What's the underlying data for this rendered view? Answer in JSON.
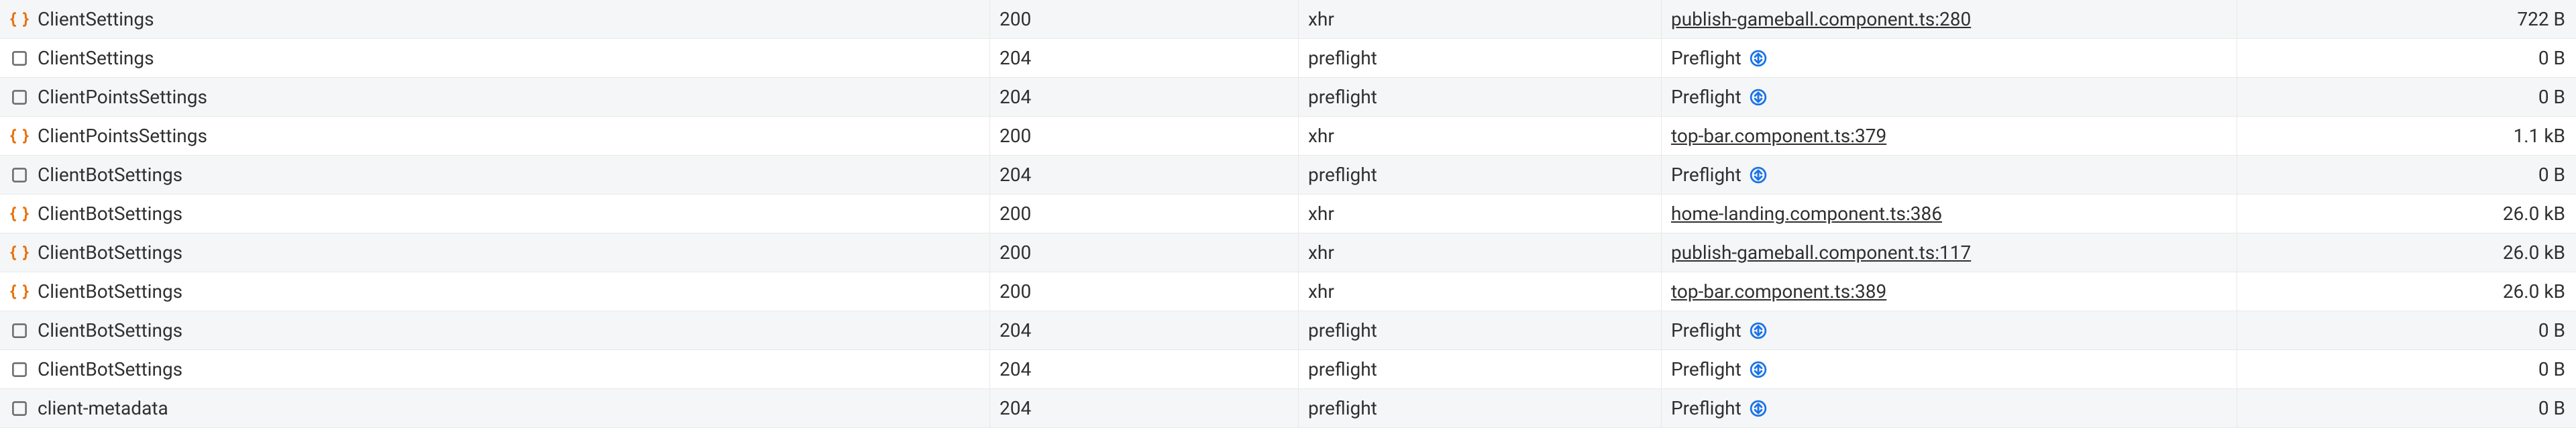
{
  "rows": [
    {
      "icon": "json",
      "name": "ClientSettings",
      "status": "200",
      "type": "xhr",
      "initiator": {
        "kind": "link",
        "text": "publish-gameball.component.ts:280"
      },
      "size": "722 B"
    },
    {
      "icon": "doc",
      "name": "ClientSettings",
      "status": "204",
      "type": "preflight",
      "initiator": {
        "kind": "preflight",
        "text": "Preflight"
      },
      "size": "0 B"
    },
    {
      "icon": "doc",
      "name": "ClientPointsSettings",
      "status": "204",
      "type": "preflight",
      "initiator": {
        "kind": "preflight",
        "text": "Preflight"
      },
      "size": "0 B"
    },
    {
      "icon": "json",
      "name": "ClientPointsSettings",
      "status": "200",
      "type": "xhr",
      "initiator": {
        "kind": "link",
        "text": "top-bar.component.ts:379"
      },
      "size": "1.1 kB"
    },
    {
      "icon": "doc",
      "name": "ClientBotSettings",
      "status": "204",
      "type": "preflight",
      "initiator": {
        "kind": "preflight",
        "text": "Preflight"
      },
      "size": "0 B"
    },
    {
      "icon": "json",
      "name": "ClientBotSettings",
      "status": "200",
      "type": "xhr",
      "initiator": {
        "kind": "link",
        "text": "home-landing.component.ts:386"
      },
      "size": "26.0 kB"
    },
    {
      "icon": "json",
      "name": "ClientBotSettings",
      "status": "200",
      "type": "xhr",
      "initiator": {
        "kind": "link",
        "text": "publish-gameball.component.ts:117"
      },
      "size": "26.0 kB"
    },
    {
      "icon": "json",
      "name": "ClientBotSettings",
      "status": "200",
      "type": "xhr",
      "initiator": {
        "kind": "link",
        "text": "top-bar.component.ts:389"
      },
      "size": "26.0 kB"
    },
    {
      "icon": "doc",
      "name": "ClientBotSettings",
      "status": "204",
      "type": "preflight",
      "initiator": {
        "kind": "preflight",
        "text": "Preflight"
      },
      "size": "0 B"
    },
    {
      "icon": "doc",
      "name": "ClientBotSettings",
      "status": "204",
      "type": "preflight",
      "initiator": {
        "kind": "preflight",
        "text": "Preflight"
      },
      "size": "0 B"
    },
    {
      "icon": "doc",
      "name": "client-metadata",
      "status": "204",
      "type": "preflight",
      "initiator": {
        "kind": "preflight",
        "text": "Preflight"
      },
      "size": "0 B"
    }
  ]
}
